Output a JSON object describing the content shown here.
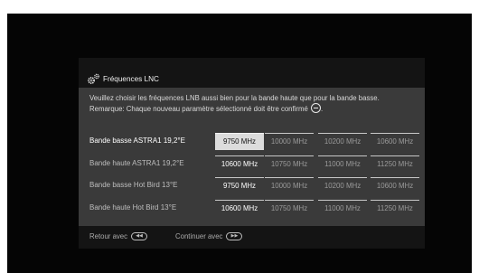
{
  "dialog": {
    "title": "Fréquences LNC",
    "note": [
      "Veuillez choisir les fréquences LNB aussi bien pour la bande haute que pour la bande basse.",
      "Remarque: Chaque nouveau paramètre sélectionné doit être confirmé"
    ],
    "note_end": ".",
    "rows": [
      {
        "label": "Bande basse ASTRA1 19,2°E",
        "selected_index": 0,
        "active": true,
        "options": [
          "9750 MHz",
          "10000 MHz",
          "10200 MHz",
          "10600 MHz"
        ]
      },
      {
        "label": "Bande haute ASTRA1 19,2°E",
        "selected_index": 0,
        "active": false,
        "options": [
          "10600 MHz",
          "10750 MHz",
          "11000 MHz",
          "11250 MHz"
        ]
      },
      {
        "label": "Bande basse Hot Bird 13°E",
        "selected_index": 0,
        "active": false,
        "options": [
          "9750 MHz",
          "10000 MHz",
          "10200 MHz",
          "10600 MHz"
        ]
      },
      {
        "label": "Bande haute Hot Bird 13°E",
        "selected_index": 0,
        "active": false,
        "options": [
          "10600 MHz",
          "10750 MHz",
          "11000 MHz",
          "11250 MHz"
        ]
      }
    ],
    "footer": {
      "back_label": "Retour avec",
      "back_key_icon": "rewind-key-icon",
      "continue_label": "Continuer avec",
      "continue_key_icon": "fast-forward-key-icon"
    }
  },
  "colors": {
    "background": "#050505",
    "panel": "#3a3a3a",
    "title_bar": "#141414",
    "focus_cell": "#dcdcdc"
  }
}
